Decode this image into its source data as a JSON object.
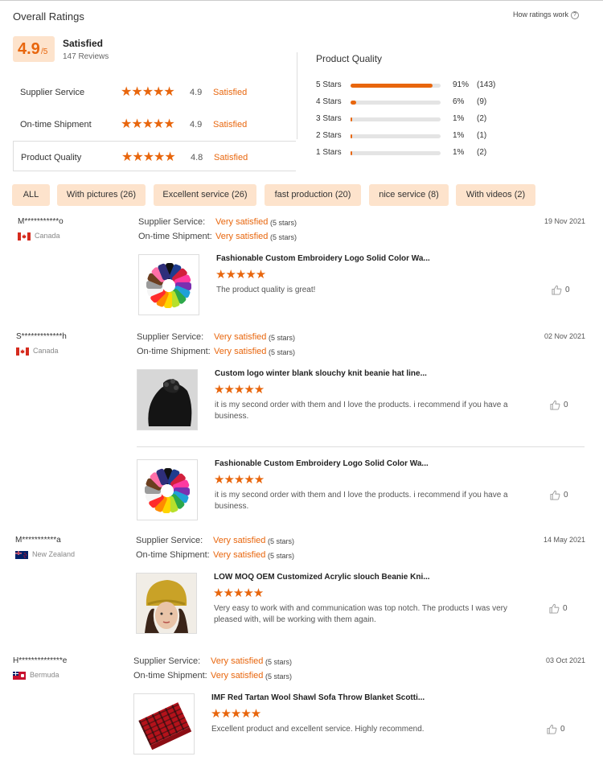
{
  "header": {
    "title": "Overall Ratings",
    "how_link": "How ratings work"
  },
  "overall": {
    "score": "4.9",
    "out_of": "/5",
    "label": "Satisfied",
    "reviews": "147 Reviews"
  },
  "metrics": [
    {
      "label": "Supplier Service",
      "value": "4.9",
      "status": "Satisfied"
    },
    {
      "label": "On-time Shipment",
      "value": "4.9",
      "status": "Satisfied"
    },
    {
      "label": "Product Quality",
      "value": "4.8",
      "status": "Satisfied"
    }
  ],
  "quality": {
    "title": "Product Quality",
    "rows": [
      {
        "label": "5 Stars",
        "pct": "91%",
        "count": "(143)",
        "fill": 0.91
      },
      {
        "label": "4 Stars",
        "pct": "6%",
        "count": "(9)",
        "fill": 0.06
      },
      {
        "label": "3 Stars",
        "pct": "1%",
        "count": "(2)",
        "fill": 0.01
      },
      {
        "label": "2 Stars",
        "pct": "1%",
        "count": "(1)",
        "fill": 0.01
      },
      {
        "label": "1 Stars",
        "pct": "1%",
        "count": "(2)",
        "fill": 0.01
      }
    ]
  },
  "filters": [
    "ALL",
    "With pictures (26)",
    "Excellent service (26)",
    "fast production (20)",
    "nice service (8)",
    "With videos (2)"
  ],
  "stars_glyph": "★★★★★",
  "labels": {
    "supplier": "Supplier Service:",
    "shipment": "On-time Shipment:",
    "very_satisfied": "Very satisfied",
    "five_stars": "(5 stars)"
  },
  "colors": {
    "accent": "#e8660d",
    "chip_bg": "#fde3cc"
  },
  "reviews": [
    {
      "name": "M***********o",
      "country": "Canada",
      "date": "19 Nov 2021",
      "items": [
        {
          "product": "Fashionable Custom Embroidery Logo Solid Color Wa...",
          "text": "The product quality is great!",
          "likes": "0",
          "image": "beanie-wheel"
        }
      ]
    },
    {
      "name": "S*************h",
      "country": "Canada",
      "date": "02 Nov 2021",
      "items": [
        {
          "product": "Custom logo winter blank slouchy knit beanie hat line...",
          "text": "it is my second order with them and I love the products. i recommend if you have a business.",
          "likes": "0",
          "image": "black-beanie"
        },
        {
          "product": "Fashionable Custom Embroidery Logo Solid Color Wa...",
          "text": "it is my second order with them and I love the products. i recommend if you have a business.",
          "likes": "0",
          "image": "beanie-wheel"
        }
      ]
    },
    {
      "name": "M***********a",
      "country": "New Zealand",
      "date": "14 May 2021",
      "items": [
        {
          "product": "LOW MOQ OEM Customized Acrylic slouch Beanie Kni...",
          "text": "Very easy to work with and communication was top notch.  The products I was very pleased with, will be working with them again.",
          "likes": "0",
          "image": "yellow-beanie"
        }
      ]
    },
    {
      "name": "H**************e",
      "country": "Bermuda",
      "date": "03 Oct 2021",
      "items": [
        {
          "product": "IMF Red Tartan Wool Shawl Sofa Throw Blanket Scotti...",
          "text": "Excellent product and excellent service.  Highly recommend.",
          "likes": "0",
          "image": "red-tartan"
        }
      ]
    }
  ]
}
